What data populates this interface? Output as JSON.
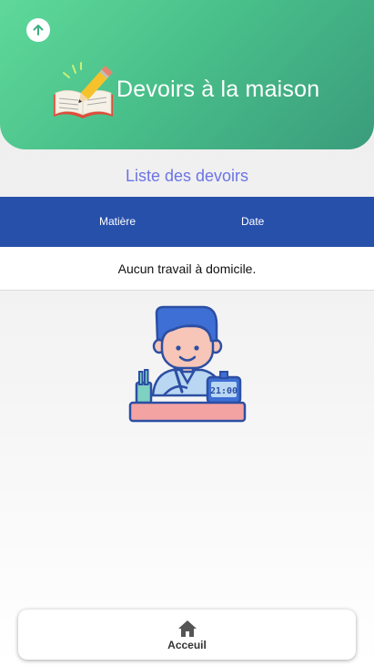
{
  "header": {
    "title": "Devoirs à la maison",
    "back_icon": "arrow-up-icon",
    "book_icon": "book-pencil-icon"
  },
  "homework": {
    "list_title": "Liste des devoirs",
    "columns": [
      "Matière",
      "Date"
    ],
    "empty_message": "Aucun travail à domicile."
  },
  "illustration": {
    "clock_text": "21:00",
    "icon": "student-writing-icon"
  },
  "bottom_nav": {
    "items": [
      {
        "label": "Acceuil",
        "icon": "home-icon"
      }
    ]
  },
  "colors": {
    "header_gradient_start": "#5fd99a",
    "header_gradient_end": "#3a9c7c",
    "table_header": "#2750ab",
    "list_title": "#6b74e6"
  }
}
